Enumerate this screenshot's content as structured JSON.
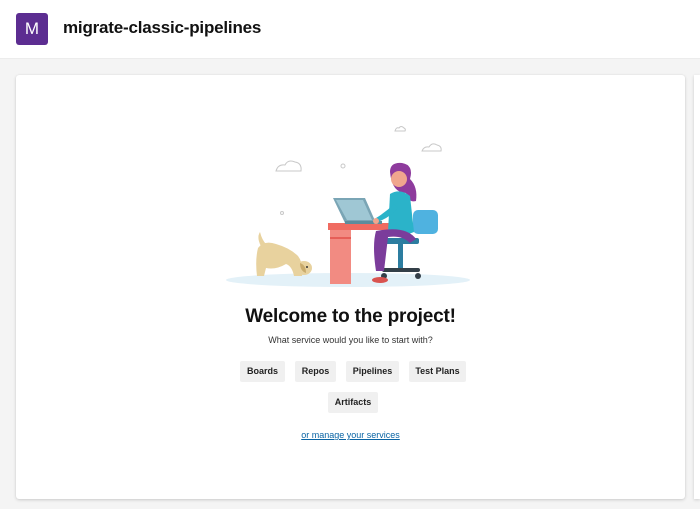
{
  "header": {
    "avatar_letter": "M",
    "project_name": "migrate-classic-pipelines"
  },
  "welcome": {
    "title": "Welcome to the project!",
    "subtitle": "What service would you like to start with?"
  },
  "services": [
    {
      "label": "Boards"
    },
    {
      "label": "Repos"
    },
    {
      "label": "Pipelines"
    },
    {
      "label": "Test Plans"
    },
    {
      "label": "Artifacts"
    }
  ],
  "manage_link": "or manage your services",
  "colors": {
    "avatar_bg": "#5c2d91",
    "link": "#0a64a4",
    "button_bg": "#f0f0f0"
  }
}
